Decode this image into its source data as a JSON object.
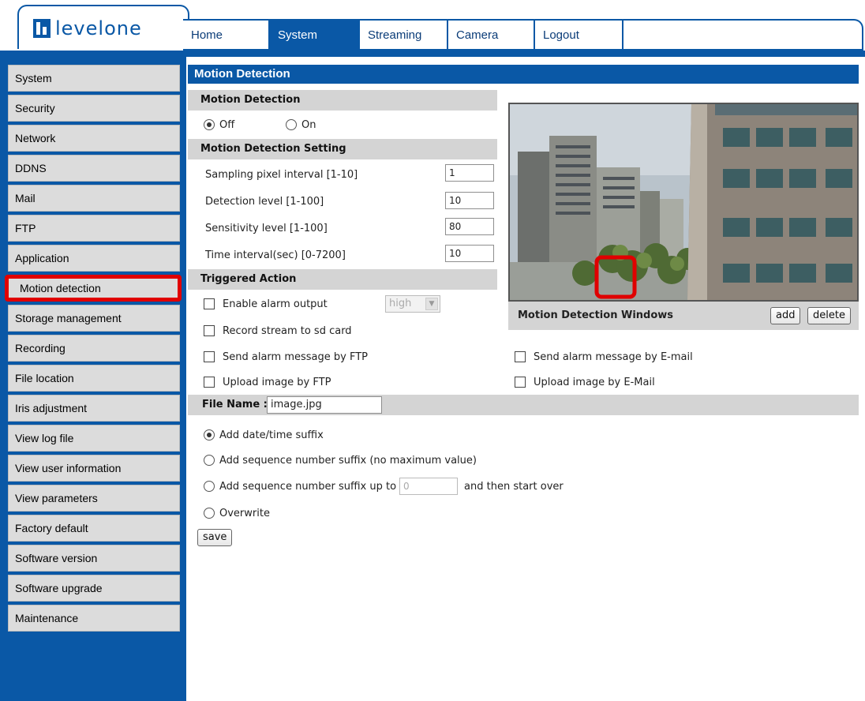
{
  "header": {
    "logo_text": "levelone",
    "tabs": [
      "Home",
      "System",
      "Streaming",
      "Camera",
      "Logout"
    ],
    "active_tab": "System"
  },
  "sidebar": {
    "items": [
      "System",
      "Security",
      "Network",
      "DDNS",
      "Mail",
      "FTP",
      "Application",
      "Motion detection",
      "Storage management",
      "Recording",
      "File location",
      "Iris adjustment",
      "View log file",
      "View user information",
      "View parameters",
      "Factory default",
      "Software version",
      "Software upgrade",
      "Maintenance"
    ],
    "highlighted": "Motion detection"
  },
  "page": {
    "title": "Motion Detection",
    "motion_detection": {
      "heading": "Motion Detection",
      "off_label": "Off",
      "on_label": "On",
      "selected": "Off"
    },
    "settings": {
      "heading": "Motion Detection Setting",
      "sampling_label": "Sampling pixel interval [1-10]",
      "sampling_value": "1",
      "detection_label": "Detection level [1-100]",
      "detection_value": "10",
      "sensitivity_label": "Sensitivity level [1-100]",
      "sensitivity_value": "80",
      "interval_label": "Time interval(sec) [0-7200]",
      "interval_value": "10"
    },
    "triggered": {
      "heading": "Triggered Action",
      "alarm_output": "Enable alarm output",
      "alarm_level": "high",
      "record_sd": "Record stream to sd card",
      "ftp_msg": "Send alarm message by FTP",
      "email_msg": "Send alarm message by E-mail",
      "ftp_upload": "Upload image by FTP",
      "email_upload": "Upload image by E-Mail"
    },
    "windows": {
      "heading": "Motion Detection Windows",
      "add": "add",
      "delete": "delete"
    },
    "file_name": {
      "label": "File Name :",
      "value": "image.jpg",
      "opt_datetime": "Add date/time suffix",
      "opt_seq_nomax": "Add sequence number suffix (no maximum value)",
      "opt_seq_upto": "Add sequence number suffix up to",
      "seq_upto_value": "0",
      "opt_seq_upto_after": "and then start over",
      "opt_overwrite": "Overwrite",
      "selected": "Add date/time suffix"
    },
    "save": "save"
  },
  "colors": {
    "brand_blue": "#0a58a6",
    "section_gray": "#d4d4d4",
    "highlight_red": "#e00000"
  }
}
